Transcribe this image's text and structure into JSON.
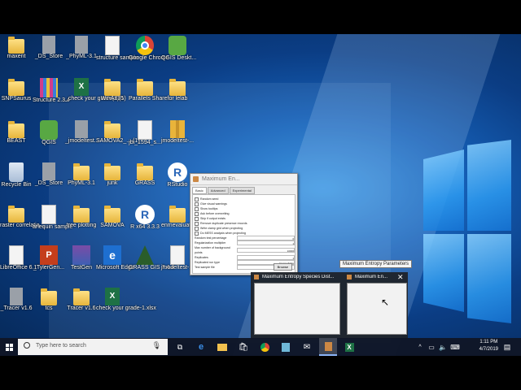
{
  "desktop": {
    "icons": [
      {
        "label": "maxent",
        "kind": "folder"
      },
      {
        "label": "_DS_Store",
        "kind": "gdoc"
      },
      {
        "label": "_PhyML-3.1",
        "kind": "gdoc"
      },
      {
        "label": "structure sample",
        "kind": "doc"
      },
      {
        "label": "Google Chrome",
        "kind": "chrome"
      },
      {
        "label": "QGIS Deskt...",
        "kind": "qgis"
      },
      {
        "label": "SNPSaurus",
        "kind": "folder"
      },
      {
        "label": "Structure 2.3.4",
        "kind": "structure"
      },
      {
        "label": "_check your grade(1)(1)",
        "kind": "xl"
      },
      {
        "label": "WinArl35",
        "kind": "folder"
      },
      {
        "label": "Parallels Share...",
        "kind": "folder"
      },
      {
        "label": "for lelab",
        "kind": "folder"
      },
      {
        "label": "BEAST",
        "kind": "folder"
      },
      {
        "label": "QGIS",
        "kind": "qgis"
      },
      {
        "label": "_jmodeltest...",
        "kind": "gdoc"
      },
      {
        "label": "SAMOVA2_... (1)",
        "kind": "folder"
      },
      {
        "label": "jbi_1594_s...",
        "kind": "doc"
      },
      {
        "label": "jmodeltest-...",
        "kind": "zip"
      },
      {
        "label": "Recycle Bin",
        "kind": "bin"
      },
      {
        "label": "_DS_Store",
        "kind": "gdoc"
      },
      {
        "label": "PhyML-3.1",
        "kind": "folder"
      },
      {
        "label": "junk",
        "kind": "folder"
      },
      {
        "label": "GRASS",
        "kind": "folder"
      },
      {
        "label": "RStudio",
        "kind": "rr"
      },
      {
        "label": "raster correlatio...",
        "kind": "folder"
      },
      {
        "label": "arlequin sample",
        "kind": "doc"
      },
      {
        "label": "tree plotting",
        "kind": "folder"
      },
      {
        "label": "SAMOVA",
        "kind": "folder"
      },
      {
        "label": "R x64 3.3.3",
        "kind": "rr"
      },
      {
        "label": "enmevaluat...",
        "kind": "folder"
      },
      {
        "label": "LibreOffice 6.1",
        "kind": "doc"
      },
      {
        "label": "_TylerGen...",
        "kind": "ppt"
      },
      {
        "label": "TestGen",
        "kind": "tg"
      },
      {
        "label": "Microsoft Edge",
        "kind": "edge"
      },
      {
        "label": "GRASS GIS 7.4.4",
        "kind": "grass"
      },
      {
        "label": "jmodeltest-...",
        "kind": "doc"
      },
      {
        "label": "_Tracer v1.6",
        "kind": "gdoc"
      },
      {
        "label": "tcs",
        "kind": "folder"
      },
      {
        "label": "Tracer v1.6",
        "kind": "folder"
      },
      {
        "label": "check your grade-1.xlsx",
        "kind": "xl"
      }
    ]
  },
  "java_window": {
    "title": "Maximum En...",
    "tabs": [
      "Basic",
      "Advanced",
      "Experimental"
    ],
    "checkboxes": [
      "Random seed",
      "Give visual warnings",
      "Show tooltips",
      "Ask before overwriting",
      "Skip if output exists",
      "Remove duplicate presence records",
      "Write clamp grid when projecting",
      "Do MESS analysis when projecting"
    ],
    "fields": [
      {
        "label": "Random test percentage",
        "value": "0"
      },
      {
        "label": "Regularization multiplier",
        "value": "1"
      },
      {
        "label": "Max number of background points",
        "value": "10000"
      },
      {
        "label": "Replicates",
        "value": "1"
      },
      {
        "label": "Replicated run type",
        "value": "Crossvalidate"
      },
      {
        "label": "Test sample file",
        "value": ""
      }
    ],
    "browse_label": "Browse"
  },
  "tooltip": "Maximum Entropy Parameters",
  "thumbnails": [
    {
      "title": "Maximum Entropy Species Dist..."
    },
    {
      "title": "Maximum En..."
    }
  ],
  "taskbar": {
    "search_placeholder": "Type here to search",
    "time": "1:11 PM",
    "date": "4/7/2019"
  }
}
